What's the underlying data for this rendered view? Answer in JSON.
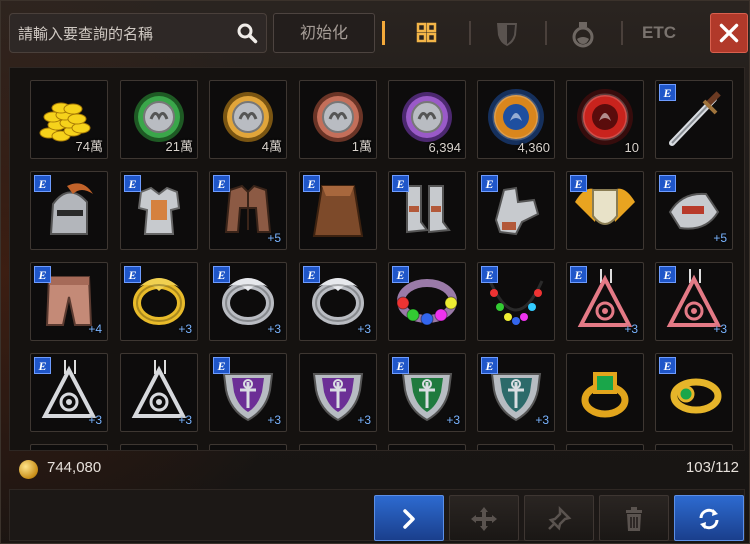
{
  "search": {
    "placeholder": "請輸入要查詢的名稱"
  },
  "toolbar": {
    "init_label": "初始化",
    "tabs": [
      {
        "icon": "grid-icon",
        "active": true
      },
      {
        "icon": "shield-icon",
        "active": false
      },
      {
        "icon": "potion-icon",
        "active": false
      },
      {
        "label": "ETC",
        "active": false
      }
    ],
    "close_icon": "close-icon"
  },
  "inventory": {
    "slots": [
      {
        "item": "gold-coins",
        "qty": "74萬"
      },
      {
        "item": "green-coin",
        "qty": "21萬"
      },
      {
        "item": "gold-coin",
        "qty": "4萬"
      },
      {
        "item": "bronze-coin",
        "qty": "1萬"
      },
      {
        "item": "purple-coin",
        "qty": "6,394"
      },
      {
        "item": "orange-emblem",
        "qty": "4,360"
      },
      {
        "item": "red-emblem",
        "qty": "10"
      },
      {
        "item": "dagger",
        "equip": true
      },
      {
        "item": "helmet",
        "equip": true
      },
      {
        "item": "armor",
        "equip": true
      },
      {
        "item": "jacket",
        "equip": true,
        "plus": "+5"
      },
      {
        "item": "cape",
        "equip": true
      },
      {
        "item": "boots",
        "equip": true
      },
      {
        "item": "gauntlet",
        "equip": true
      },
      {
        "item": "winged-shield",
        "equip": true
      },
      {
        "item": "bracer",
        "equip": true,
        "plus": "+5"
      },
      {
        "item": "pants",
        "equip": true,
        "plus": "+4"
      },
      {
        "item": "gold-ring-ornate",
        "equip": true,
        "plus": "+3"
      },
      {
        "item": "silver-ring",
        "equip": true,
        "plus": "+3"
      },
      {
        "item": "silver-ring-2",
        "equip": true,
        "plus": "+3"
      },
      {
        "item": "bead-bracelet",
        "equip": true
      },
      {
        "item": "bead-necklace",
        "equip": true
      },
      {
        "item": "pink-earring",
        "equip": true,
        "plus": "+3"
      },
      {
        "item": "pink-earring-2",
        "equip": true,
        "plus": "+3"
      },
      {
        "item": "silver-earring",
        "equip": true,
        "plus": "+3"
      },
      {
        "item": "silver-earring-2",
        "equip": false,
        "plus": "+3"
      },
      {
        "item": "purple-crest",
        "equip": true,
        "plus": "+3"
      },
      {
        "item": "purple-crest-2",
        "equip": false,
        "plus": "+3"
      },
      {
        "item": "green-crest",
        "equip": true,
        "plus": "+3"
      },
      {
        "item": "teal-crest",
        "equip": true,
        "plus": "+3"
      },
      {
        "item": "emerald-ring",
        "equip": false
      },
      {
        "item": "gold-ring-green",
        "equip": true
      }
    ]
  },
  "footer": {
    "money": "744,080",
    "capacity": "103/112"
  },
  "bottom_buttons": [
    {
      "icon": "next-icon",
      "active": true
    },
    {
      "icon": "move-icon",
      "active": false
    },
    {
      "icon": "pin-icon",
      "active": false
    },
    {
      "icon": "trash-icon",
      "active": false
    },
    {
      "icon": "refresh-icon",
      "active": true
    }
  ],
  "colors": {
    "accent": "#f3a93a",
    "close": "#b1392a",
    "equip_badge": "#1f56c9",
    "plus_text": "#7ab4ff"
  }
}
